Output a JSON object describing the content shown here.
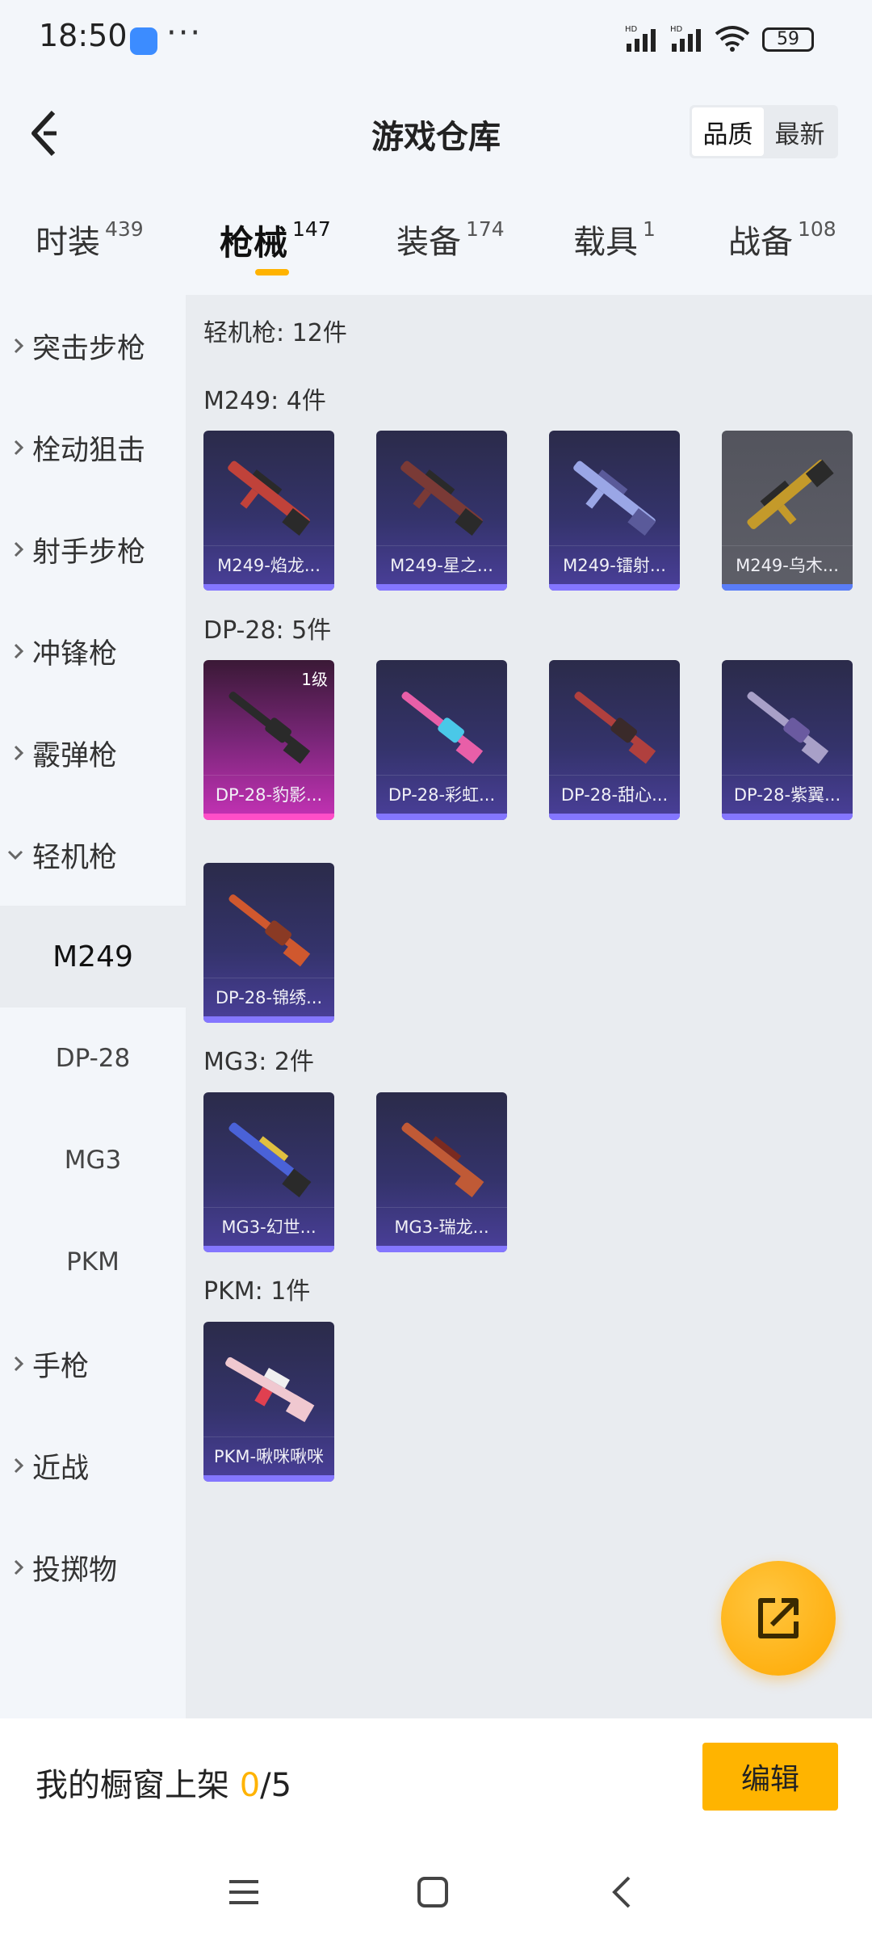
{
  "status_bar": {
    "time": "18:50",
    "dots": "···",
    "battery": "59"
  },
  "header": {
    "title": "游戏仓库",
    "sort_options": [
      "品质",
      "最新"
    ],
    "active_sort": "品质"
  },
  "tabs": [
    {
      "label": "时装",
      "count": "439"
    },
    {
      "label": "枪械",
      "count": "147"
    },
    {
      "label": "装备",
      "count": "174"
    },
    {
      "label": "载具",
      "count": "1"
    },
    {
      "label": "战备",
      "count": "108"
    }
  ],
  "active_tab": "枪械",
  "sidebar": {
    "items": [
      {
        "label": "突击步枪"
      },
      {
        "label": "栓动狙击"
      },
      {
        "label": "射手步枪"
      },
      {
        "label": "冲锋枪"
      },
      {
        "label": "霰弹枪"
      },
      {
        "label": "轻机枪"
      }
    ],
    "subitems": [
      {
        "label": "M249"
      },
      {
        "label": "DP-28"
      },
      {
        "label": "MG3"
      },
      {
        "label": "PKM"
      }
    ],
    "items_after": [
      {
        "label": "手枪"
      },
      {
        "label": "近战"
      },
      {
        "label": "投掷物"
      }
    ]
  },
  "content": {
    "category_title": "轻机枪: 12件",
    "groups": [
      {
        "title": "M249: 4件",
        "cards": [
          {
            "name": "M249-焰龙...",
            "gun_color": "#c0423a"
          },
          {
            "name": "M249-星之...",
            "gun_color": "#7a3a36"
          },
          {
            "name": "M249-镭射...",
            "gun_color": "#9aa6e6"
          },
          {
            "name": "M249-乌木...",
            "gun_color": "#c49a2a"
          }
        ]
      },
      {
        "title": "DP-28: 5件",
        "cards": [
          {
            "name": "DP-28-豹影...",
            "level": "1级",
            "gun_color": "#2a2a2a"
          },
          {
            "name": "DP-28-彩虹...",
            "gun_color": "#e85fa8"
          },
          {
            "name": "DP-28-甜心...",
            "gun_color": "#b0403e"
          },
          {
            "name": "DP-28-紫翼...",
            "gun_color": "#a8a0c8"
          },
          {
            "name": "DP-28-锦绣...",
            "gun_color": "#d0582e"
          }
        ]
      },
      {
        "title": "MG3: 2件",
        "cards": [
          {
            "name": "MG3-幻世...",
            "gun_color": "#4a62d8"
          },
          {
            "name": "MG3-瑞龙...",
            "gun_color": "#c05a36"
          }
        ]
      },
      {
        "title": "PKM: 1件",
        "cards": [
          {
            "name": "PKM-啾咪啾咪",
            "gun_color": "#f0c8d0"
          }
        ]
      }
    ]
  },
  "bottom": {
    "label": "我的橱窗上架",
    "count": "0",
    "total": "/5",
    "edit_label": "编辑"
  },
  "colors": {
    "accent": "#ffb300",
    "card_purple": "#34336b",
    "card_pink": "#c532b6",
    "card_gray": "#5e5f68"
  }
}
